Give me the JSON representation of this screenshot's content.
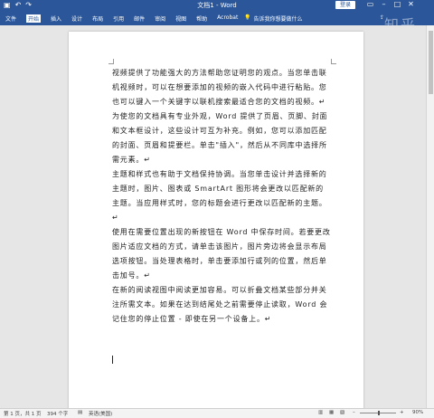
{
  "title": {
    "app_title": "文档1 - Word",
    "login_label": "登录",
    "quick_access": [
      "save-icon",
      "undo-icon",
      "redo-icon"
    ]
  },
  "ribbon": {
    "tabs": [
      "文件",
      "开始",
      "插入",
      "设计",
      "布局",
      "引用",
      "邮件",
      "审阅",
      "视图",
      "帮助",
      "Acrobat"
    ],
    "tell_me": "告诉我你想要做什么",
    "share_icon": "share-icon"
  },
  "document": {
    "paragraphs": [
      "视频提供了功能强大的方法帮助您证明您的观点。当您单击联机视频时，可以在想要添加的视频的嵌入代码中进行粘贴。您也可以键入一个关键字以联机搜索最适合您的文档的视频。↵",
      "为使您的文档具有专业外观，Word 提供了页眉、页脚、封面和文本框设计，这些设计可互为补充。例如，您可以添加匹配的封面、页眉和提要栏。单击\"插入\"，然后从不同库中选择所需元素。↵",
      "主题和样式也有助于文档保持协调。当您单击设计并选择新的主题时，图片、图表或 SmartArt 图形将会更改以匹配新的主题。当应用样式时，您的标题会进行更改以匹配新的主题。↵",
      "使用在需要位置出现的新按钮在 Word 中保存时间。若要更改图片适应文档的方式，请单击该图片，图片旁边将会显示布局选项按钮。当处理表格时，单击要添加行或列的位置，然后单击加号。↵",
      "在新的阅读视图中阅读更加容易。可以折叠文档某些部分并关注所需文本。如果在达到结尾处之前需要停止读取，Word 会记住您的停止位置 - 即使在另一个设备上。↵"
    ]
  },
  "status": {
    "page": "第 1 页，共 1 页",
    "words": "394 个字",
    "language": "英语(美国)",
    "zoom": "90%"
  },
  "watermark": "知乎"
}
